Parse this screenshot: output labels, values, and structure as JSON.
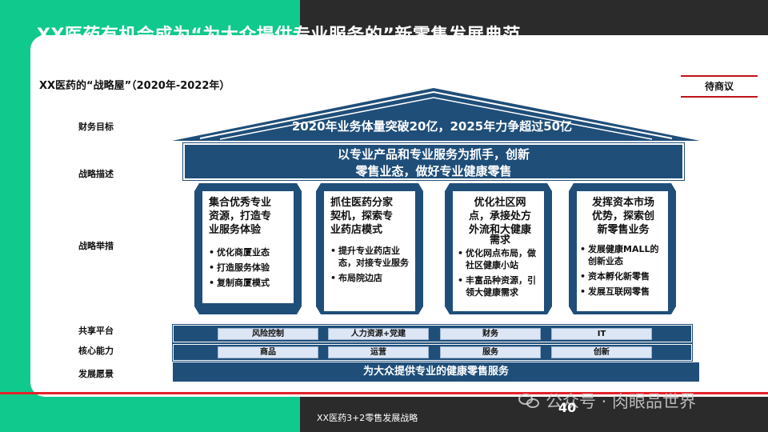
{
  "slide": {
    "title": "XX医药有机会成为“为大众提供专业服务的”新零售发展典范",
    "subtitle": "XX医药的“战略屋”（2020年-2022年）",
    "pending_label": "待商议",
    "footer_text": "XX医药3+2零售发展战略",
    "page_number": "40",
    "watermark": "公众号 · 肉眼品世界"
  },
  "row_labels": {
    "financial": "财务目标",
    "description": "战略描述",
    "measures": "战略举措",
    "platform": "共享平台",
    "capability": "核心能力",
    "vision": "发展愿景"
  },
  "roof": {
    "text": "2020年业务体量突破20亿，2025年力争超过50亿"
  },
  "strategy": {
    "line1": "以专业产品和专业服务为抓手，创新",
    "line2": "零售业态，做好专业健康零售"
  },
  "pillars": [
    {
      "title_lines": [
        "集合优秀专业",
        "资源，打造专",
        "业服务体验"
      ],
      "items": [
        "优化商厦业态",
        "打造服务体验",
        "复制商厦模式"
      ]
    },
    {
      "title_lines": [
        "抓住医药分家",
        "契机，探索专",
        "业药店模式"
      ],
      "items": [
        "提升专业药店业态，对接专业服务",
        "布局院边店"
      ]
    },
    {
      "title_lines": [
        "优化社区网",
        "点，承接处方",
        "外流和大健康",
        "需求"
      ],
      "items": [
        "优化网点布局，做社区健康小站",
        "丰富品种资源，引领大健康需求"
      ]
    },
    {
      "title_lines": [
        "发挥资本市场",
        "优势，探索创",
        "新零售业务"
      ],
      "items": [
        "发展健康MALL的创新业态",
        "资本孵化新零售",
        "发展互联网零售"
      ]
    }
  ],
  "platform": [
    "风险控制",
    "人力资源+党建",
    "财务",
    "IT"
  ],
  "capability": [
    "商品",
    "运营",
    "服务",
    "创新"
  ],
  "vision": {
    "text": "为大众提供专业的健康零售服务"
  },
  "colors": {
    "navy": "#1f4e79",
    "green": "#10c98c",
    "dark": "#2b2b2b",
    "red": "#e3212a",
    "chip": "#dce6f4"
  }
}
